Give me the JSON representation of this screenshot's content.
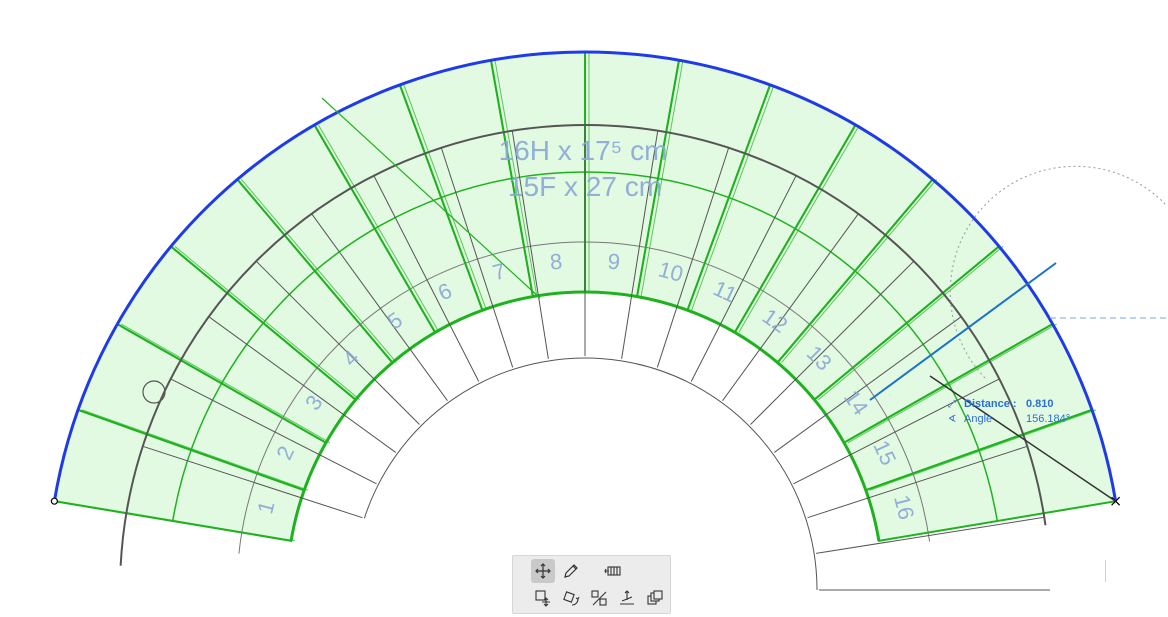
{
  "stair": {
    "riser_summary": "16H x 17⁵ cm",
    "tread_summary": "15F x 27 cm",
    "tread_numbers": [
      "1",
      "2",
      "3",
      "4",
      "5",
      "6",
      "7",
      "8",
      "9",
      "10",
      "11",
      "12",
      "13",
      "14",
      "15",
      "16"
    ]
  },
  "tracker": {
    "distance_label": "Distance :",
    "distance_value": "0.810",
    "angle_label": "Angle",
    "angle_value": "156.184°"
  },
  "palette": {
    "tools": [
      "move-icon",
      "pencil-icon",
      "stair-edit-icon",
      "drag-icon",
      "rotate-icon",
      "mirror-icon",
      "elevate-icon",
      "multiply-icon"
    ],
    "active_tool": "move-icon"
  },
  "colors": {
    "boundary_blue": "#1f3be8",
    "tread_fill": "#d8f7d8",
    "tread_green": "#1fb21f",
    "walkline_gray": "#555555",
    "label_blue": "#8aa7d6",
    "tracker_blue": "#2a6fd6"
  }
}
